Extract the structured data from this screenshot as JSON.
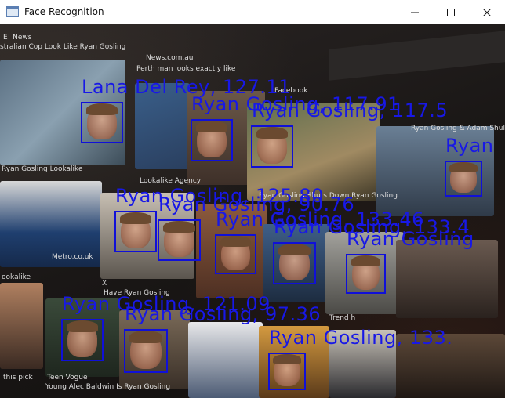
{
  "window": {
    "title": "Face Recognition",
    "app_icon": "app-window-icon",
    "controls": [
      "minimize-icon",
      "maximize-icon",
      "close-icon"
    ]
  },
  "browser": {
    "source_labels": [
      "E! News",
      "News.com.au",
      "Facebook",
      "Lookalike Agency",
      "Metro.co.uk",
      "Teen Vogue",
      "Facebook",
      "X"
    ],
    "snippets": [
      "stralian Cop Look Like Ryan Gosling",
      "Perth man looks exactly like",
      "Ryan Gosling & Adam Shulma",
      "Ryan Gosling Lookalike",
      "Ryan Gosling Shuts Down Ryan Gosling",
      "Have Ryan Gosling",
      "Young Alec Baldwin Is Ryan Gosling",
      "ookalike",
      "Ryan Gosling Lookalike",
      "etro.co.uk",
      "Trend h",
      "this pick"
    ]
  },
  "detections": [
    {
      "label": "Lana Del Rey, 127.11"
    },
    {
      "label": "Ryan Gosling, 117.91"
    },
    {
      "label": "Ryan Gosling, 117.5"
    },
    {
      "label": "Ryan"
    },
    {
      "label": "Ryan Gosling, 125.80"
    },
    {
      "label": "Ryan Gosling, 90.76"
    },
    {
      "label": "Ryan Gosling, 133.46"
    },
    {
      "label": "Ryan Gosling, 133.4"
    },
    {
      "label": "Ryan Gosling, 121.09"
    },
    {
      "label": "Ryan Gosling, 97.36"
    },
    {
      "label": "Ryan Gosling, 133."
    },
    {
      "label": "Ryan Gosling"
    }
  ],
  "colors": {
    "box": "#1010d8",
    "label": "#1818e6",
    "titlebar": "#ffffff"
  }
}
